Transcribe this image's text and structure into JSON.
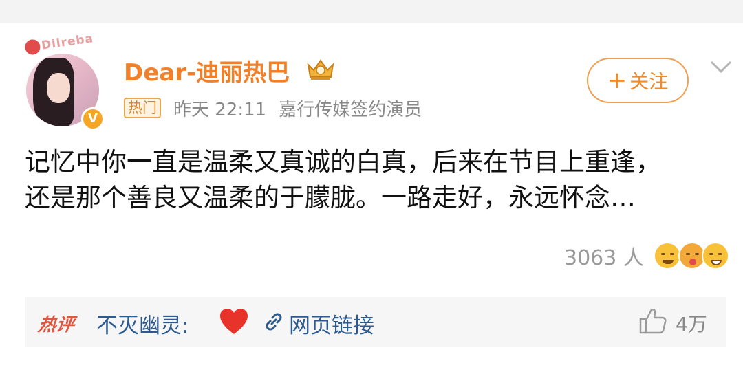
{
  "user": {
    "name": "Dear-迪丽热巴",
    "avatar_deco_text": "Dilreba",
    "verified_mark": "V"
  },
  "meta": {
    "hot_tag": "热门",
    "time": "昨天 22:11",
    "description": "嘉行传媒签约演员"
  },
  "follow": {
    "plus": "+",
    "label": "关注"
  },
  "post": {
    "lines": [
      "记忆中你一直是温柔又真诚的白真，后来在节目上重逢，",
      "还是那个善良又温柔的于朦胧。一路走好，永远怀念…"
    ]
  },
  "reactions": {
    "count": "3063 人",
    "icons": [
      "smile-icon",
      "kiss-icon",
      "grin-icon"
    ]
  },
  "hot_comment": {
    "label": "热评",
    "author": "不灭幽灵:",
    "heart": "heart-icon",
    "link_text": "网页链接",
    "likes": "4万"
  },
  "colors": {
    "username": "#f0812a",
    "follow_border": "#f0a050",
    "link_blue": "#2e5b8f",
    "hot_red": "#e0553f",
    "heart_red": "#e8332a"
  }
}
